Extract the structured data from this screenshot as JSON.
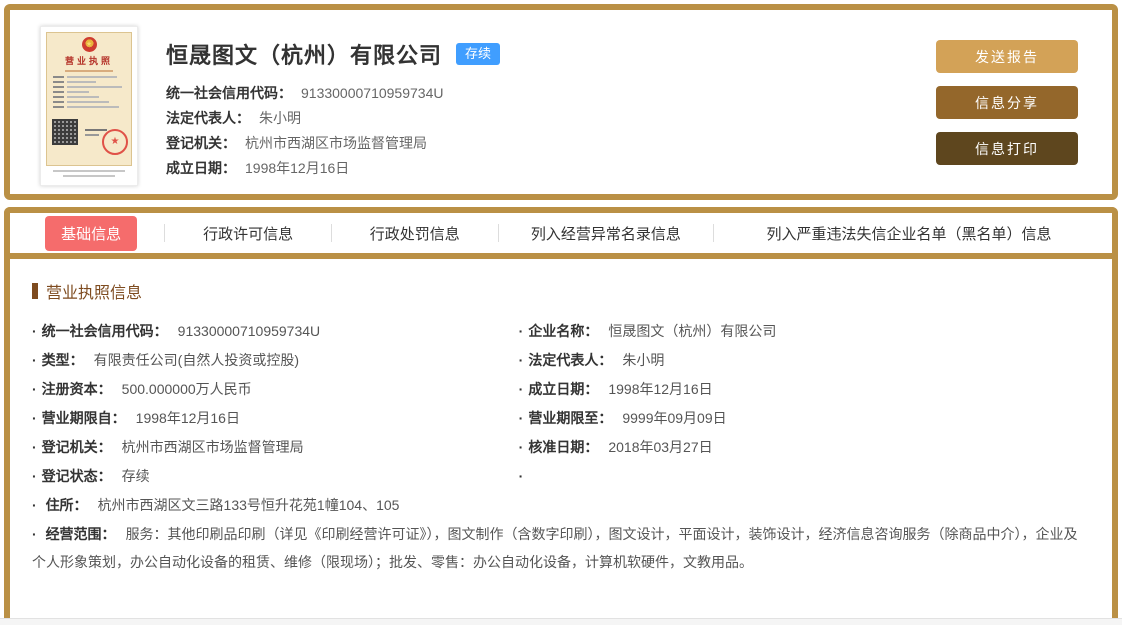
{
  "colors": {
    "frame_gold": "#BA9045",
    "badge_blue": "#409EFF",
    "tab_active_red": "#F56C6C",
    "section_brown": "#7E4B1F",
    "button_send": "#D3A257",
    "button_share": "#94672B",
    "button_print": "#5E461E"
  },
  "header": {
    "company_name": "恒晟图文（杭州）有限公司",
    "status_badge": "存续",
    "license_title": "营业执照",
    "fields": [
      {
        "label": "统一社会信用代码：",
        "value": "91330000710959734U"
      },
      {
        "label": "法定代表人：",
        "value": "朱小明"
      },
      {
        "label": "登记机关：",
        "value": "杭州市西湖区市场监督管理局"
      },
      {
        "label": "成立日期：",
        "value": "1998年12月16日"
      }
    ],
    "buttons": [
      {
        "label": "发送报告"
      },
      {
        "label": "信息分享"
      },
      {
        "label": "信息打印"
      }
    ]
  },
  "tabs": [
    {
      "label": "基础信息",
      "active": true
    },
    {
      "label": "行政许可信息",
      "active": false
    },
    {
      "label": "行政处罚信息",
      "active": false
    },
    {
      "label": "列入经营异常名录信息",
      "active": false
    },
    {
      "label": "列入严重违法失信企业名单（黑名单）信息",
      "active": false
    }
  ],
  "section": {
    "title": "营业执照信息",
    "fields_left": [
      {
        "label": "统一社会信用代码：",
        "value": "91330000710959734U"
      },
      {
        "label": "类型：",
        "value": "有限责任公司(自然人投资或控股)"
      },
      {
        "label": "注册资本：",
        "value": "500.000000万人民币"
      },
      {
        "label": "营业期限自：",
        "value": "1998年12月16日"
      },
      {
        "label": "登记机关：",
        "value": "杭州市西湖区市场监督管理局"
      },
      {
        "label": "登记状态：",
        "value": "存续"
      }
    ],
    "fields_right": [
      {
        "label": "企业名称：",
        "value": "恒晟图文（杭州）有限公司"
      },
      {
        "label": "法定代表人：",
        "value": "朱小明"
      },
      {
        "label": "成立日期：",
        "value": "1998年12月16日"
      },
      {
        "label": "营业期限至：",
        "value": "9999年09月09日"
      },
      {
        "label": "核准日期：",
        "value": "2018年03月27日"
      }
    ],
    "fields_full": [
      {
        "label": "住所：",
        "value": "杭州市西湖区文三路133号恒升花苑1幢104、105"
      },
      {
        "label": "经营范围：",
        "value": "服务：其他印刷品印刷（详见《印刷经营许可证》），图文制作（含数字印刷），图文设计，平面设计，装饰设计，经济信息咨询服务（除商品中介），企业及个人形象策划，办公自动化设备的租赁、维修（限现场）；批发、零售：办公自动化设备，计算机软硬件，文教用品。"
      }
    ]
  }
}
